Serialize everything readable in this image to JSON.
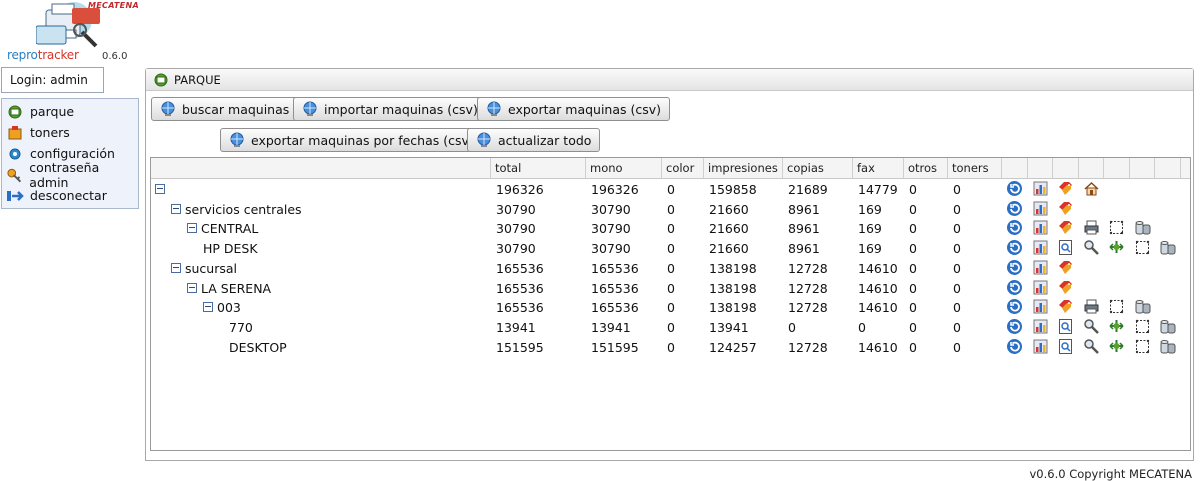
{
  "app": {
    "brand_part1": "repro",
    "brand_part2": "tracker",
    "version": "0.6.0",
    "maker": "MECATENA"
  },
  "login": {
    "label": "Login: admin"
  },
  "menu": [
    {
      "label": "parque",
      "icon": "parque-icon"
    },
    {
      "label": "toners",
      "icon": "toners-icon"
    },
    {
      "label": "configuración",
      "icon": "gear-icon"
    },
    {
      "label": "contraseña admin",
      "icon": "key-icon"
    },
    {
      "label": "desconectar",
      "icon": "logout-arrow-icon"
    }
  ],
  "panel": {
    "title": "PARQUE"
  },
  "buttons": {
    "buscar": "buscar maquinas",
    "importar": "importar maquinas (csv)",
    "exportar": "exportar maquinas (csv)",
    "exportar_fechas": "exportar maquinas por fechas (csv)",
    "actualizar": "actualizar todo"
  },
  "table": {
    "columns": [
      "total",
      "mono",
      "color",
      "impresiones",
      "copias",
      "fax",
      "otros",
      "toners"
    ],
    "rows": [
      {
        "name": "",
        "level": 0,
        "toggle": true,
        "total": "196326",
        "mono": "196326",
        "color": "0",
        "impresiones": "159858",
        "copias": "21689",
        "fax": "14779",
        "otros": "0",
        "toners": "0",
        "icons": [
          "refresh-icon",
          "chart-icon",
          "tags-icon",
          "home-icon"
        ]
      },
      {
        "name": "servicios centrales",
        "level": 1,
        "toggle": true,
        "total": "30790",
        "mono": "30790",
        "color": "0",
        "impresiones": "21660",
        "copias": "8961",
        "fax": "169",
        "otros": "0",
        "toners": "0",
        "icons": [
          "refresh-icon",
          "chart-icon",
          "tags-icon"
        ]
      },
      {
        "name": "CENTRAL",
        "level": 2,
        "toggle": true,
        "total": "30790",
        "mono": "30790",
        "color": "0",
        "impresiones": "21660",
        "copias": "8961",
        "fax": "169",
        "otros": "0",
        "toners": "0",
        "icons": [
          "refresh-icon",
          "chart-icon",
          "tags-icon",
          "printer-icon",
          "frame-icon",
          "toner-icon"
        ]
      },
      {
        "name": "HP DESK",
        "level": 3,
        "toggle": false,
        "total": "30790",
        "mono": "30790",
        "color": "0",
        "impresiones": "21660",
        "copias": "8961",
        "fax": "169",
        "otros": "0",
        "toners": "0",
        "icons": [
          "refresh-icon",
          "chart-icon",
          "search-doc-icon",
          "magnify-icon",
          "move-icon",
          "frame-icon",
          "toner-icon"
        ]
      },
      {
        "name": "sucursal",
        "level": 1,
        "toggle": true,
        "total": "165536",
        "mono": "165536",
        "color": "0",
        "impresiones": "138198",
        "copias": "12728",
        "fax": "14610",
        "otros": "0",
        "toners": "0",
        "icons": [
          "refresh-icon",
          "chart-icon",
          "tags-icon"
        ]
      },
      {
        "name": "LA SERENA",
        "level": 2,
        "toggle": true,
        "total": "165536",
        "mono": "165536",
        "color": "0",
        "impresiones": "138198",
        "copias": "12728",
        "fax": "14610",
        "otros": "0",
        "toners": "0",
        "icons": [
          "refresh-icon",
          "chart-icon",
          "tags-icon"
        ]
      },
      {
        "name": "003",
        "level": 3,
        "toggle": true,
        "total": "165536",
        "mono": "165536",
        "color": "0",
        "impresiones": "138198",
        "copias": "12728",
        "fax": "14610",
        "otros": "0",
        "toners": "0",
        "icons": [
          "refresh-icon",
          "chart-icon",
          "tags-icon",
          "printer-icon",
          "frame-icon",
          "toner-icon"
        ]
      },
      {
        "name": "770",
        "level": 4,
        "toggle": false,
        "total": "13941",
        "mono": "13941",
        "color": "0",
        "impresiones": "13941",
        "copias": "0",
        "fax": "0",
        "otros": "0",
        "toners": "0",
        "icons": [
          "refresh-icon",
          "chart-icon",
          "search-doc-icon",
          "magnify-icon",
          "move-icon",
          "frame-icon",
          "toner-icon"
        ]
      },
      {
        "name": "DESKTOP",
        "level": 4,
        "toggle": false,
        "total": "151595",
        "mono": "151595",
        "color": "0",
        "impresiones": "124257",
        "copias": "12728",
        "fax": "14610",
        "otros": "0",
        "toners": "0",
        "icons": [
          "refresh-icon",
          "chart-icon",
          "search-doc-icon",
          "magnify-icon",
          "move-icon",
          "frame-icon",
          "toner-icon"
        ]
      }
    ]
  },
  "footer": "v0.6.0 Copyright MECATENA"
}
